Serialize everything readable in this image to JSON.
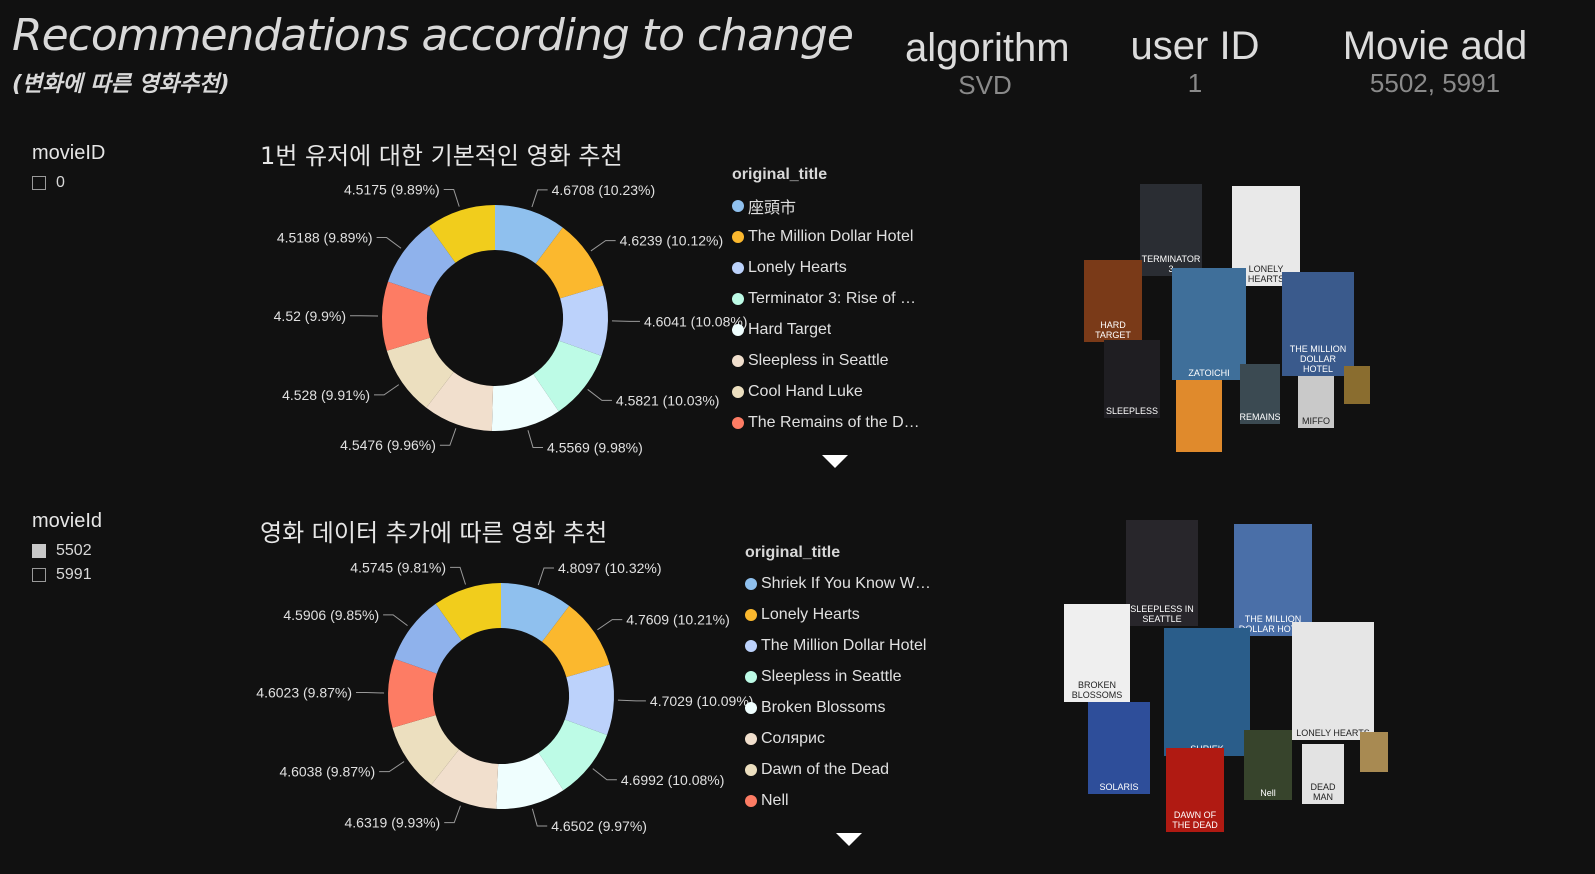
{
  "title": "Recommendations according to change",
  "subtitle": "(변화에 따른 영화추천)",
  "cards": [
    {
      "label": "algorithm",
      "value": "SVD"
    },
    {
      "label": "user ID",
      "value": "1"
    },
    {
      "label": "Movie add",
      "value": "5502, 5991"
    }
  ],
  "slicer_top": {
    "title": "movieID",
    "items": [
      {
        "label": "0",
        "checked": false
      }
    ]
  },
  "slicer_bottom": {
    "title": "movieId",
    "items": [
      {
        "label": "5502",
        "checked": true
      },
      {
        "label": "5991",
        "checked": false
      }
    ]
  },
  "colors": [
    "#8fc0ee",
    "#fbb82e",
    "#bcd2fb",
    "#bdfbe6",
    "#effefe",
    "#f1dfcd",
    "#ecdfbf",
    "#fd7c64",
    "#8fb2ec",
    "#f1cd1c"
  ],
  "chart_data": [
    {
      "type": "pie",
      "title": "1번 유저에 대한 기본적인 영화 추천",
      "legend_title": "original_title",
      "legend": [
        "座頭市",
        "The Million Dollar Hotel",
        "Lonely Hearts",
        "Terminator 3: Rise of …",
        "Hard Target",
        "Sleepless in Seattle",
        "Cool Hand Luke",
        "The Remains of the D…"
      ],
      "values": [
        4.6708,
        4.6239,
        4.6041,
        4.5821,
        4.5569,
        4.5476,
        4.528,
        4.52,
        4.5188,
        4.5175
      ],
      "data_labels": [
        "4.6708 (10.23%)",
        "4.6239 (10.12%)",
        "4.6041 (10.08%)",
        "4.5821 (10.03%)",
        "4.5569 (9.98%)",
        "4.5476 (9.96%)",
        "4.528 (9.91%)",
        "4.52 (9.9%)",
        "4.5188 (9.89%)",
        "4.5175 (9.89%)"
      ]
    },
    {
      "type": "pie",
      "title": "영화 데이터 추가에 따른 영화 추천",
      "legend_title": "original_title",
      "legend": [
        "Shriek If You Know W…",
        "Lonely Hearts",
        "The Million Dollar Hotel",
        "Sleepless in Seattle",
        "Broken Blossoms",
        "Солярис",
        "Dawn of the Dead",
        "Nell"
      ],
      "values": [
        4.8097,
        4.7609,
        4.7029,
        4.6992,
        4.6502,
        4.6319,
        4.6038,
        4.6023,
        4.5906,
        4.5745
      ],
      "data_labels": [
        "4.8097 (10.32%)",
        "4.7609 (10.21%)",
        "4.7029 (10.09%)",
        "4.6992 (10.08%)",
        "4.6502 (9.97%)",
        "4.6319 (9.93%)",
        "4.6038 (9.87%)",
        "4.6023 (9.87%)",
        "4.5906 (9.85%)",
        "4.5745 (9.81%)"
      ]
    }
  ],
  "posters_top": [
    {
      "name": "terminator3",
      "text": "TERMINATOR 3",
      "color": "#2a2d33"
    },
    {
      "name": "lonely-hearts",
      "text": "LONELY HEARTS",
      "color": "#e9e9e9"
    },
    {
      "name": "hard-target",
      "text": "HARD TARGET",
      "color": "#7a3a18"
    },
    {
      "name": "zatoichi",
      "text": "ZATOICHI",
      "color": "#3f6f9a"
    },
    {
      "name": "million-dollar-hotel",
      "text": "THE MILLION DOLLAR HOTEL",
      "color": "#3a5a8c"
    },
    {
      "name": "sleepless",
      "text": "SLEEPLESS",
      "color": "#1f1e22"
    },
    {
      "name": "cool-hand",
      "text": "",
      "color": "#e08a2c"
    },
    {
      "name": "remains",
      "text": "REMAINS",
      "color": "#3b4a52"
    },
    {
      "name": "miffo",
      "text": "MIFFO",
      "color": "#c9c9c9"
    },
    {
      "name": "small",
      "text": "",
      "color": "#8a6d2f"
    }
  ],
  "posters_bottom": [
    {
      "name": "sleepless",
      "text": "SLEEPLESS IN SEATTLE",
      "color": "#28262b"
    },
    {
      "name": "million-dollar-hotel",
      "text": "THE MILLION DOLLAR HOTEL",
      "color": "#4a6fa8"
    },
    {
      "name": "broken-blossoms",
      "text": "BROKEN BLOSSOMS",
      "color": "#efefef"
    },
    {
      "name": "shriek",
      "text": "SHRIEK",
      "color": "#2a5d8a"
    },
    {
      "name": "lonely-hearts",
      "text": "LONELY HEARTS",
      "color": "#e6e6e6"
    },
    {
      "name": "solaris",
      "text": "SOLARIS",
      "color": "#2e4e9a"
    },
    {
      "name": "dawn-dead",
      "text": "DAWN OF THE DEAD",
      "color": "#b01a12"
    },
    {
      "name": "nell",
      "text": "Nell",
      "color": "#37442c"
    },
    {
      "name": "dead-man",
      "text": "DEAD MAN",
      "color": "#e3e3e3"
    },
    {
      "name": "small",
      "text": "",
      "color": "#a88a52"
    }
  ]
}
